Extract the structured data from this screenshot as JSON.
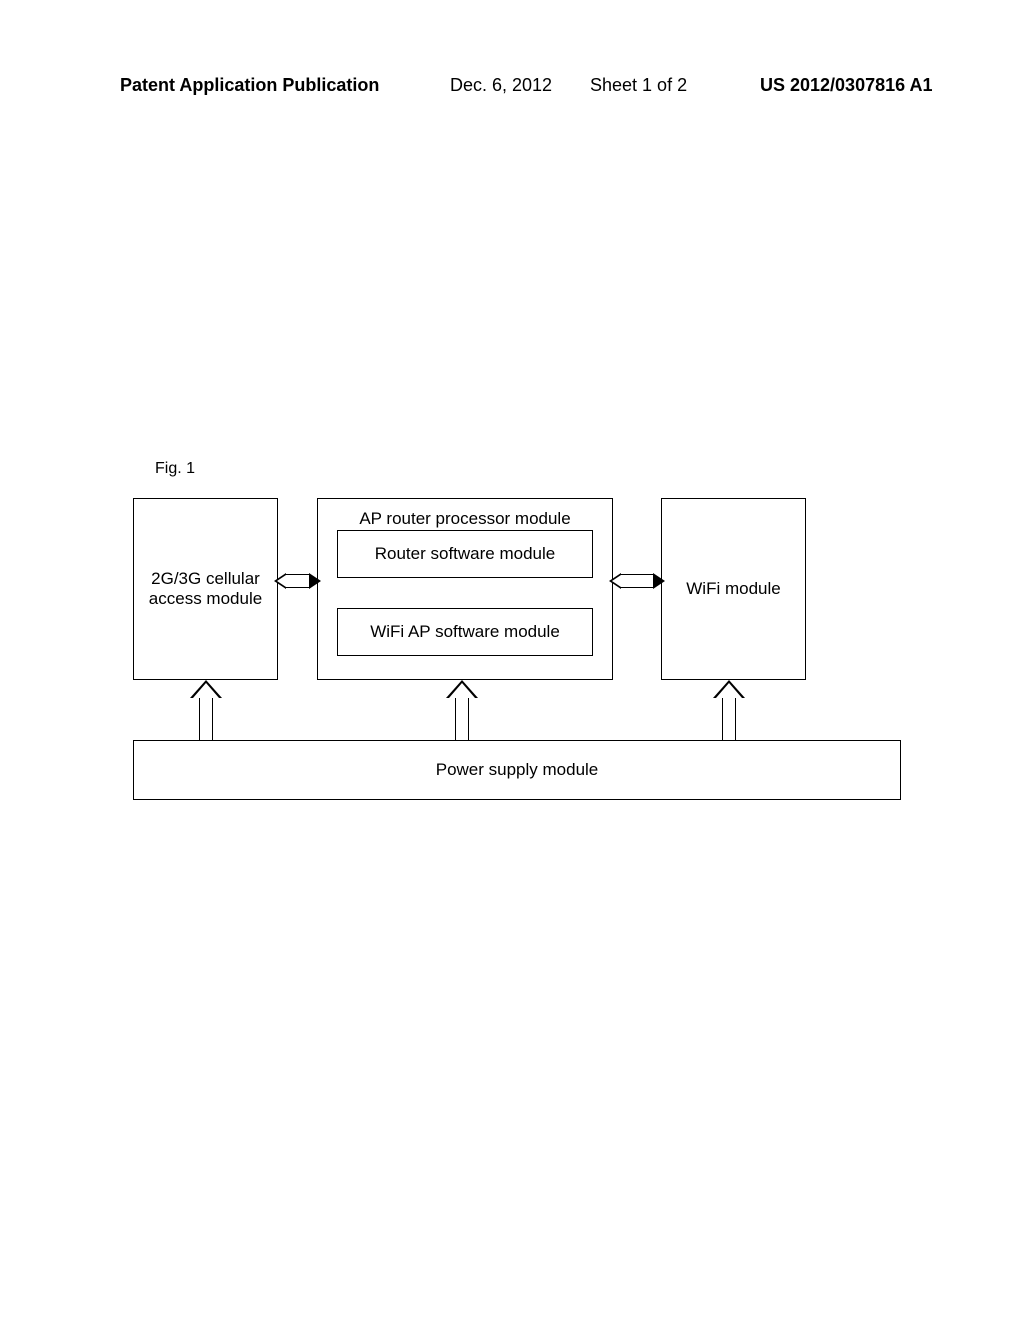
{
  "header": {
    "publication": "Patent Application Publication",
    "date": "Dec. 6, 2012",
    "sheet": "Sheet 1 of 2",
    "docnum": "US 2012/0307816 A1"
  },
  "figure": {
    "label": "Fig. 1"
  },
  "diagram": {
    "cellular": "2G/3G cellular access module",
    "ap_router_title": "AP router processor module",
    "router_software": "Router software module",
    "wifi_ap_software": "WiFi AP software module",
    "wifi_module": "WiFi module",
    "power": "Power supply module"
  }
}
